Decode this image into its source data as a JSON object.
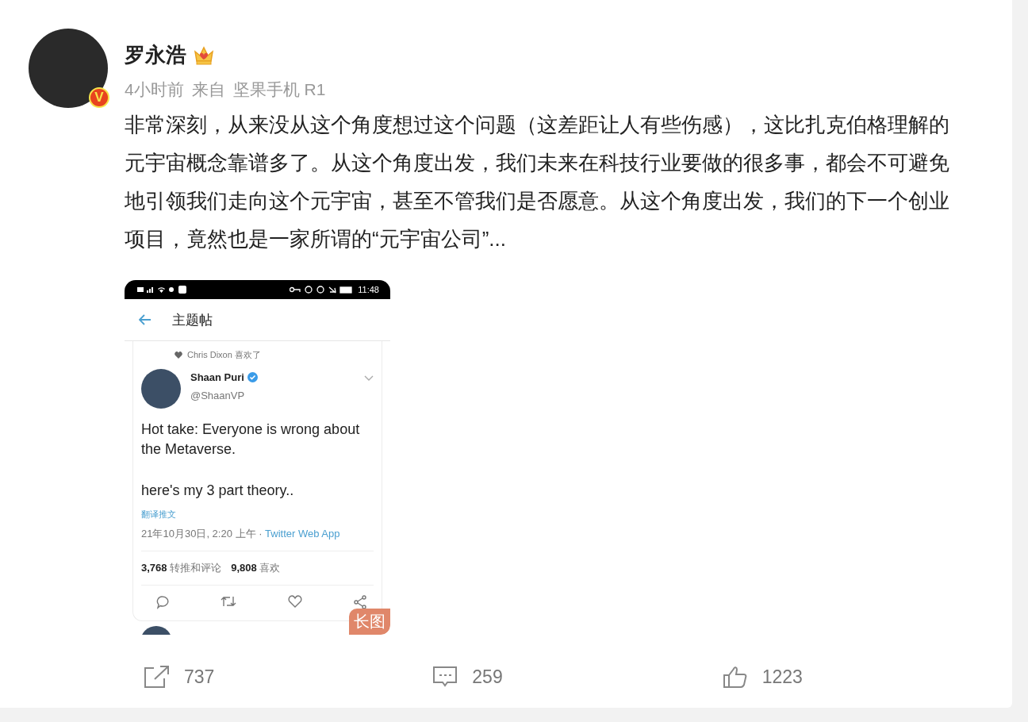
{
  "post": {
    "author": "罗永浩",
    "verified_badge": "V",
    "time": "4小时前",
    "source_label": "来自",
    "source": "坚果手机 R1",
    "text": "非常深刻，从来没从这个角度想过这个问题（这差距让人有些伤感），这比扎克伯格理解的元宇宙概念靠谱多了。从这个角度出发，我们未来在科技行业要做的很多事，都会不可避免地引领我们走向这个元宇宙，甚至不管我们是否愿意。从这个角度出发，我们的下一个创业项目，竟然也是一家所谓的“元宇宙公司”...",
    "image": {
      "status_time": "11:48",
      "header_title": "主题帖",
      "liked_by": "Chris Dixon 喜欢了",
      "tweet_author": "Shaan Puri",
      "tweet_handle": "@ShaanVP",
      "tweet_paragraphs": [
        "Hot take: Everyone is wrong about the Metaverse.",
        "here's my 3 part theory.."
      ],
      "translate_link": "翻译推文",
      "date": "21年10月30日, 2:20 上午 · ",
      "client": "Twitter Web App",
      "stats": [
        {
          "count": "3,768",
          "label": "转推和评论"
        },
        {
          "count": "9,808",
          "label": "喜欢"
        }
      ],
      "badge": "长图"
    }
  },
  "actions": [
    {
      "kind": "repost",
      "count": "737"
    },
    {
      "kind": "comment",
      "count": "259"
    },
    {
      "kind": "like",
      "count": "1223"
    }
  ]
}
